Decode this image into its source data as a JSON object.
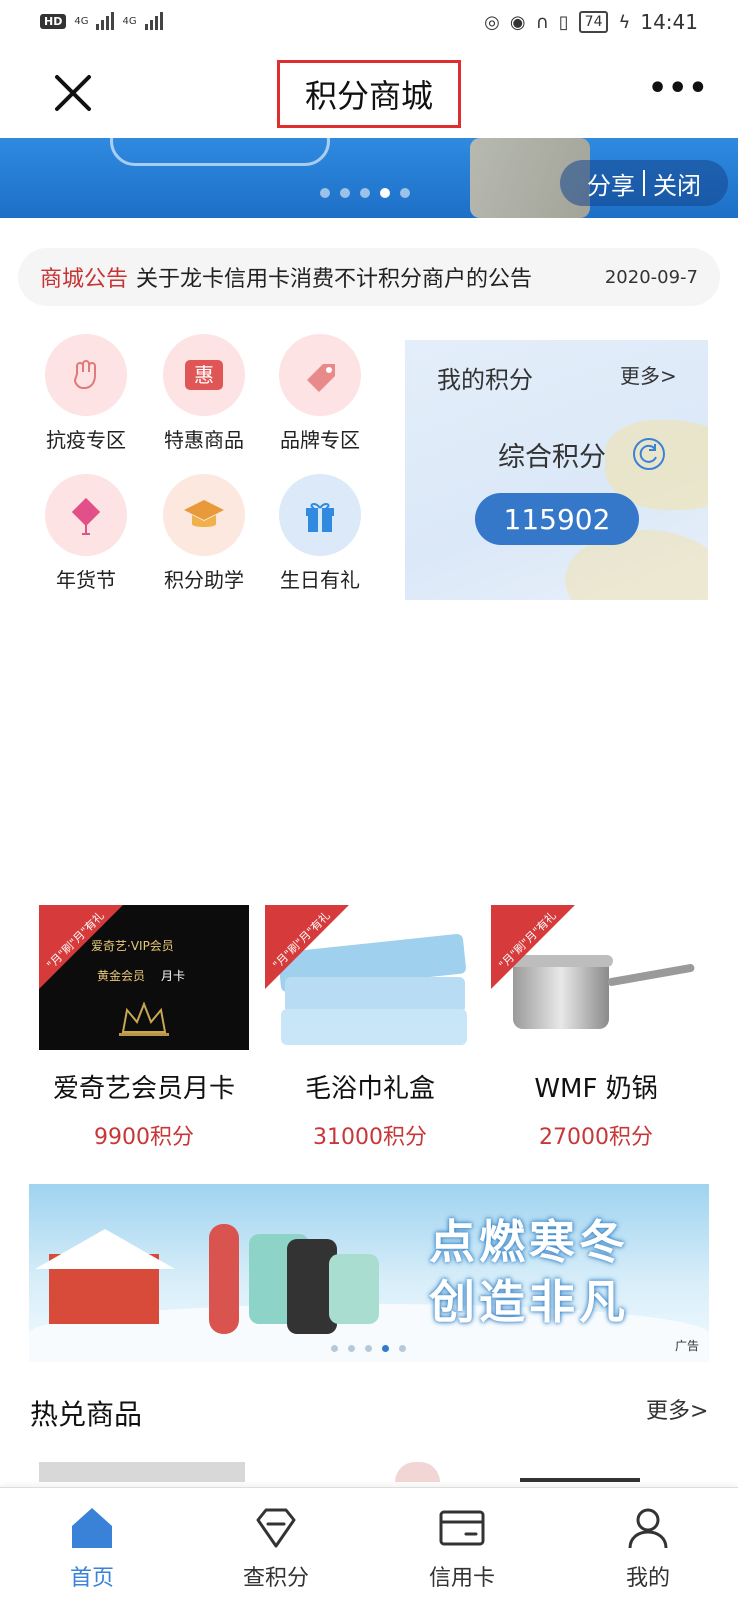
{
  "status_bar": {
    "hd": "HD",
    "network1": "4G",
    "network2": "4G",
    "battery": "74",
    "time": "14:41"
  },
  "header": {
    "title": "积分商城",
    "close_icon": "close-icon",
    "more_icon": "more-dots-icon",
    "title_highlight_color": "#e02d2d"
  },
  "top_banner": {
    "share_label": "分享",
    "close_label": "关闭",
    "dot_count": 5,
    "active_dot": 3
  },
  "notice": {
    "tag": "商城公告",
    "text": "关于龙卡信用卡消费不计积分商户的公告",
    "date": "2020-09-7"
  },
  "categories": [
    {
      "label": "抗疫专区",
      "icon": "fist-icon"
    },
    {
      "label": "特惠商品",
      "icon": "discount-tag-icon"
    },
    {
      "label": "品牌专区",
      "icon": "price-tag-icon"
    },
    {
      "label": "年货节",
      "icon": "chinese-knot-icon"
    },
    {
      "label": "积分助学",
      "icon": "graduation-cap-icon"
    },
    {
      "label": "生日有礼",
      "icon": "gift-box-icon"
    }
  ],
  "my_points": {
    "title": "我的积分",
    "more": "更多>",
    "total_label": "综合积分",
    "value": "115902"
  },
  "products": [
    {
      "name": "爱奇艺会员月卡",
      "price": "9900积分",
      "ribbon": "\"月\"刷\"月\"有礼"
    },
    {
      "name": "毛浴巾礼盒",
      "price": "31000积分",
      "ribbon": "\"月\"刷\"月\"有礼"
    },
    {
      "name": "WMF 奶锅",
      "price": "27000积分",
      "ribbon": "\"月\"刷\"月\"有礼"
    }
  ],
  "iqiyi_card": {
    "brand": "爱奇艺·VIP会员",
    "tier": "黄金会员",
    "period": "月卡"
  },
  "winter_ad": {
    "line1": "点燃寒冬",
    "line2": "创造非凡",
    "ad_tag": "广告",
    "dot_count": 5,
    "active_dot": 4
  },
  "hot": {
    "title": "热兑商品",
    "more": "更多>"
  },
  "bottom_nav": [
    {
      "label": "首页",
      "icon": "home-icon",
      "active": true
    },
    {
      "label": "查积分",
      "icon": "diamond-icon",
      "active": false
    },
    {
      "label": "信用卡",
      "icon": "credit-card-icon",
      "active": false
    },
    {
      "label": "我的",
      "icon": "user-icon",
      "active": false
    }
  ],
  "colors": {
    "accent_blue": "#3577c9",
    "nav_active": "#3a82d8",
    "price_red": "#c83737",
    "notice_red": "#c63434"
  }
}
